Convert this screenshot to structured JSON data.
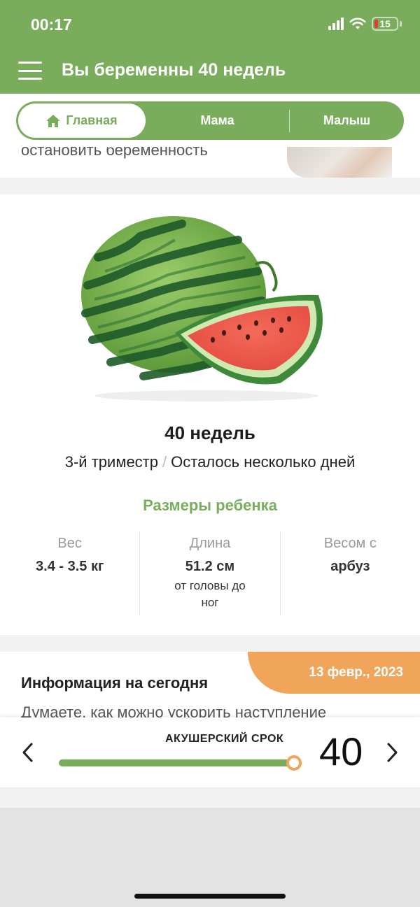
{
  "status": {
    "time": "00:17",
    "battery": "15"
  },
  "header": {
    "title": "Вы беременны 40 недель"
  },
  "tabs": [
    {
      "label": "Главная",
      "icon": "home-icon",
      "active": true
    },
    {
      "label": "Мама",
      "active": false
    },
    {
      "label": "Малыш",
      "active": false
    }
  ],
  "article": {
    "text": "остановить беременность"
  },
  "main": {
    "fruit_icon": "watermelon",
    "weeks": "40 недель",
    "trimester": "3-й триместр",
    "separator": "/",
    "days_left": "Осталось несколько дней",
    "sizes_title": "Размеры ребенка",
    "stats": [
      {
        "label": "Вес",
        "value": "3.4 - 3.5 кг",
        "note": ""
      },
      {
        "label": "Длина",
        "value": "51.2 см",
        "note": "от головы до ног"
      },
      {
        "label": "Весом с",
        "value": "арбуз",
        "note": ""
      }
    ]
  },
  "info": {
    "date": "13 февр., 2023",
    "title": "Информация на сегодня",
    "text": "Думаете, как можно ускорить наступление"
  },
  "term": {
    "label": "АКУШЕРСКИЙ СРОК",
    "value": "40",
    "progress": 0.97
  },
  "colors": {
    "brand": "#79ad5c",
    "accent": "#f0a55b"
  }
}
